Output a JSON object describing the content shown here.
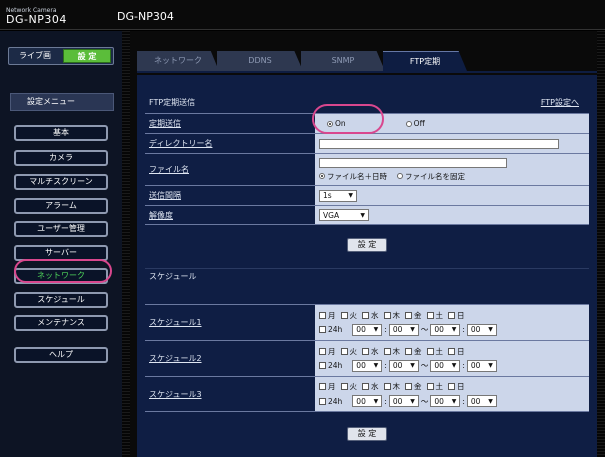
{
  "logo": {
    "line1": "Network Camera",
    "line2": "DG-NP304"
  },
  "model": "DG-NP304",
  "sidebar": {
    "live_label": "ライブ画",
    "setup_label": "設 定",
    "menu_title": "設定メニュー",
    "items": [
      {
        "label": "基本"
      },
      {
        "label": "カメラ"
      },
      {
        "label": "マルチスクリーン"
      },
      {
        "label": "アラーム"
      },
      {
        "label": "ユーザー管理"
      },
      {
        "label": "サーバー"
      },
      {
        "label": "ネットワーク"
      },
      {
        "label": "スケジュール"
      },
      {
        "label": "メンテナンス"
      },
      {
        "label": "ヘルプ"
      }
    ]
  },
  "tabs": [
    {
      "label": "ネットワーク"
    },
    {
      "label": "DDNS"
    },
    {
      "label": "SNMP"
    },
    {
      "label": "FTP定期"
    }
  ],
  "ftp": {
    "section_title": "FTP定期送信",
    "settings_link": "FTP設定へ",
    "periodic_label": "定期送信",
    "on_label": "On",
    "off_label": "Off",
    "periodic_value": "On",
    "directory_label": "ディレクトリー名",
    "directory_value": "",
    "filename_label": "ファイル名",
    "filename_value": "",
    "filename_opt1": "ファイル名＋日時",
    "filename_opt2": "ファイル名を固定",
    "interval_label": "送信間隔",
    "interval_value": "1s",
    "resolution_label": "解像度",
    "resolution_value": "VGA",
    "set_label": "設 定"
  },
  "schedule": {
    "section_title": "スケジュール",
    "days": [
      "月",
      "火",
      "水",
      "木",
      "金",
      "土",
      "日"
    ],
    "allday_label": "24h",
    "tilde": "～",
    "colon": ":",
    "rows": [
      {
        "label": "スケジュール1",
        "start_h": "00",
        "start_m": "00",
        "end_h": "00",
        "end_m": "00"
      },
      {
        "label": "スケジュール2",
        "start_h": "00",
        "start_m": "00",
        "end_h": "00",
        "end_m": "00"
      },
      {
        "label": "スケジュール3",
        "start_h": "00",
        "start_m": "00",
        "end_h": "00",
        "end_m": "00"
      }
    ],
    "set_label": "設 定"
  }
}
